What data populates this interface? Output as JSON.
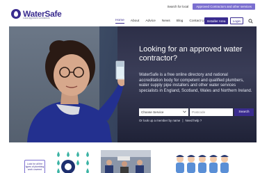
{
  "topbar": {
    "search_local": "Search for local",
    "approved_contractors": "Approved Contractors and other services"
  },
  "logo": {
    "name_a": "Water",
    "name_b": "Safe",
    "tagline": "Local approved contractors"
  },
  "nav": {
    "items": [
      "Home",
      "About",
      "Advice",
      "News",
      "Blog",
      "Contact Us"
    ],
    "installer_area": "Installer Area",
    "login": "Login"
  },
  "hero": {
    "title": "Looking for an approved water contractor?",
    "text": "WaterSafe is a free online directory and national accreditation body for competent and qualified plumbers, water supply pipe installers and other water services specialists in England, Scotland, Wales and Northern Ireland.",
    "select_value": "Choose Service",
    "postcode_placeholder": "Postcode",
    "search_label": "Search",
    "link_lookup": "Or look up a member by name",
    "link_separator": "|",
    "link_help": "Need help ?"
  },
  "cards": {
    "card1_text": "Look for all the types of plumbing work covered"
  },
  "colors": {
    "brand": "#3a2c8f",
    "accent": "#7b6fd0",
    "hero_dark": "#2e3a55"
  }
}
